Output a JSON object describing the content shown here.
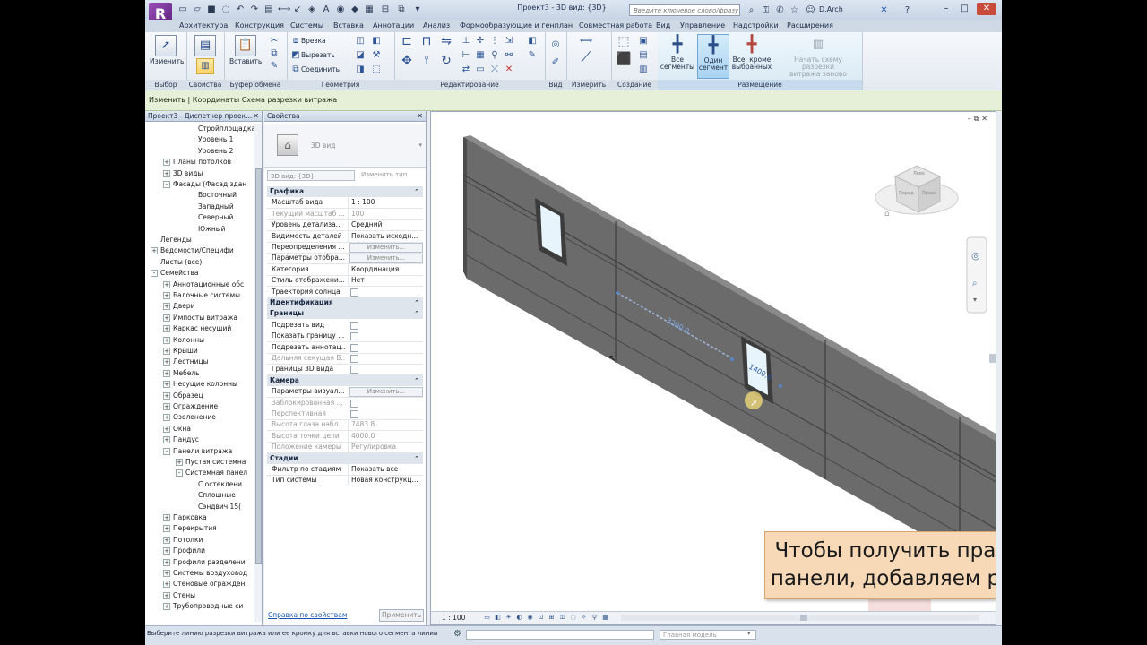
{
  "title_bar": {
    "title": "Проект3 - 3D вид: {3D}",
    "search_placeholder": "Введите ключевое слово/фразу",
    "user": "D.Arch"
  },
  "tabs": [
    "Архитектура",
    "Конструкция",
    "Системы",
    "Вставка",
    "Аннотации",
    "Анализ",
    "Формообразующие и генплан",
    "Совместная работа",
    "Вид",
    "Управление",
    "Надстройки",
    "Расширения"
  ],
  "ribbon": {
    "modify": {
      "label": "Изменить",
      "panel": "Выбор"
    },
    "properties_panel": "Свойства",
    "clipboard": {
      "paste": "Вставить",
      "panel": "Буфер обмена"
    },
    "geometry": {
      "cope": "Врезка",
      "cut": "Вырезать",
      "join": "Соединить",
      "panel": "Геометрия"
    },
    "edit_panel": "Редактирование",
    "view_panel": "Вид",
    "measure_panel": "Измерить",
    "create_panel": "Создание",
    "placement": {
      "all_segments": [
        "Все",
        "сегменты"
      ],
      "one_segment": [
        "Один",
        "сегмент"
      ],
      "all_except": [
        "Все, кроме",
        "выбранных"
      ],
      "restart": [
        "Начать схему разрезки",
        "витража заново"
      ],
      "panel": "Размещение"
    }
  },
  "context_bar": "Изменить | Координаты Схема разрезки витража",
  "project_browser": {
    "title": "Проект3 - Диспетчер проек...",
    "items": [
      {
        "label": "Стройплощадка",
        "level": 3,
        "exp": ""
      },
      {
        "label": "Уровень 1",
        "level": 3,
        "exp": ""
      },
      {
        "label": "Уровень 2",
        "level": 3,
        "exp": ""
      },
      {
        "label": "Планы потолков",
        "level": 1,
        "exp": "+"
      },
      {
        "label": "3D виды",
        "level": 1,
        "exp": "+"
      },
      {
        "label": "Фасады (Фасад здан",
        "level": 1,
        "exp": "-"
      },
      {
        "label": "Восточный",
        "level": 3,
        "exp": ""
      },
      {
        "label": "Западный",
        "level": 3,
        "exp": ""
      },
      {
        "label": "Северный",
        "level": 3,
        "exp": ""
      },
      {
        "label": "Южный",
        "level": 3,
        "exp": ""
      },
      {
        "label": "Легенды",
        "level": 0,
        "exp": ""
      },
      {
        "label": "Ведомости/Специфи",
        "level": 0,
        "exp": "+"
      },
      {
        "label": "Листы (все)",
        "level": 0,
        "exp": ""
      },
      {
        "label": "Семейства",
        "level": 0,
        "exp": "-"
      },
      {
        "label": "Аннотационные обс",
        "level": 1,
        "exp": "+"
      },
      {
        "label": "Балочные системы",
        "level": 1,
        "exp": "+"
      },
      {
        "label": "Двери",
        "level": 1,
        "exp": "+"
      },
      {
        "label": "Импосты витража",
        "level": 1,
        "exp": "+"
      },
      {
        "label": "Каркас несущий",
        "level": 1,
        "exp": "+"
      },
      {
        "label": "Колонны",
        "level": 1,
        "exp": "+"
      },
      {
        "label": "Крыши",
        "level": 1,
        "exp": "+"
      },
      {
        "label": "Лестницы",
        "level": 1,
        "exp": "+"
      },
      {
        "label": "Мебель",
        "level": 1,
        "exp": "+"
      },
      {
        "label": "Несущие колонны",
        "level": 1,
        "exp": "+"
      },
      {
        "label": "Образец",
        "level": 1,
        "exp": "+"
      },
      {
        "label": "Ограждение",
        "level": 1,
        "exp": "+"
      },
      {
        "label": "Озеленение",
        "level": 1,
        "exp": "+"
      },
      {
        "label": "Окна",
        "level": 1,
        "exp": "+"
      },
      {
        "label": "Пандус",
        "level": 1,
        "exp": "+"
      },
      {
        "label": "Панели витража",
        "level": 1,
        "exp": "-"
      },
      {
        "label": "Пустая системна",
        "level": 2,
        "exp": "+"
      },
      {
        "label": "Системная панел",
        "level": 2,
        "exp": "-"
      },
      {
        "label": "С остеклени",
        "level": 3,
        "exp": ""
      },
      {
        "label": "Сплошные",
        "level": 3,
        "exp": ""
      },
      {
        "label": "Сэндвич 15(",
        "level": 3,
        "exp": ""
      },
      {
        "label": "Парковка",
        "level": 1,
        "exp": "+"
      },
      {
        "label": "Перекрытия",
        "level": 1,
        "exp": "+"
      },
      {
        "label": "Потолки",
        "level": 1,
        "exp": "+"
      },
      {
        "label": "Профили",
        "level": 1,
        "exp": "+"
      },
      {
        "label": "Профили разделени",
        "level": 1,
        "exp": "+"
      },
      {
        "label": "Системы воздуховод",
        "level": 1,
        "exp": "+"
      },
      {
        "label": "Стеновые огражден",
        "level": 1,
        "exp": "+"
      },
      {
        "label": "Стены",
        "level": 1,
        "exp": "+"
      },
      {
        "label": "Трубопроводные си",
        "level": 1,
        "exp": "+"
      }
    ]
  },
  "properties": {
    "title": "Свойства",
    "type_name": "3D вид",
    "type_select": "3D вид: {3D}",
    "edit_type": "Изменить тип",
    "help": "Справка по свойствам",
    "apply": "Применить",
    "rows": [
      {
        "kind": "cat",
        "label": "Графика"
      },
      {
        "k": "Масштаб вида",
        "v": "1 : 100"
      },
      {
        "k": "Текущий масштаб ...",
        "v": "100",
        "dim": true
      },
      {
        "k": "Уровень детализа...",
        "v": "Средний"
      },
      {
        "k": "Видимость деталей",
        "v": "Показать исходн..."
      },
      {
        "k": "Переопределения ...",
        "btn": "Изменить..."
      },
      {
        "k": "Параметры отобра...",
        "btn": "Изменить..."
      },
      {
        "k": "Категория",
        "v": "Координация"
      },
      {
        "k": "Стиль отображени...",
        "v": "Нет"
      },
      {
        "k": "Траектория солнца",
        "check": true
      },
      {
        "kind": "cat",
        "label": "Идентификация"
      },
      {
        "kind": "cat",
        "label": "Границы"
      },
      {
        "k": "Подрезать вид",
        "check": true
      },
      {
        "k": "Показать границу ...",
        "check": true
      },
      {
        "k": "Подрезать аннотац...",
        "check": true
      },
      {
        "k": "Дальняя секущая В...",
        "check": true,
        "dim": true
      },
      {
        "k": "Границы 3D вида",
        "check": true
      },
      {
        "kind": "cat",
        "label": "Камера"
      },
      {
        "k": "Параметры визуал...",
        "btn": "Изменить..."
      },
      {
        "k": "Заблокированная ...",
        "check": true,
        "dim": true
      },
      {
        "k": "Перспективная",
        "check": true,
        "dim": true
      },
      {
        "k": "Высота глаза набл...",
        "v": "7483.8",
        "dim": true
      },
      {
        "k": "Высота точки цели",
        "v": "4000.0",
        "dim": true
      },
      {
        "k": "Положение камеры",
        "v": "Регулировка",
        "dim": true
      },
      {
        "kind": "cat",
        "label": "Стадии"
      },
      {
        "k": "Фильтр по стадиям",
        "v": "Показать все"
      },
      {
        "k": "Тип системы",
        "v": "Новая конструкц..."
      }
    ]
  },
  "viewport": {
    "dim_long": "3200.0",
    "dim_short": "1400.0",
    "view_cube": [
      "Лево",
      "Перед",
      "Право"
    ],
    "scale": "1 : 100",
    "callout": [
      "Чтобы получить правильные",
      "панели, добавляем разрезку!"
    ]
  },
  "status_bar": {
    "text": "Выберите линию разрезки витража или ее кромку для вставки нового сегмента линии",
    "model": "Главная модель"
  }
}
